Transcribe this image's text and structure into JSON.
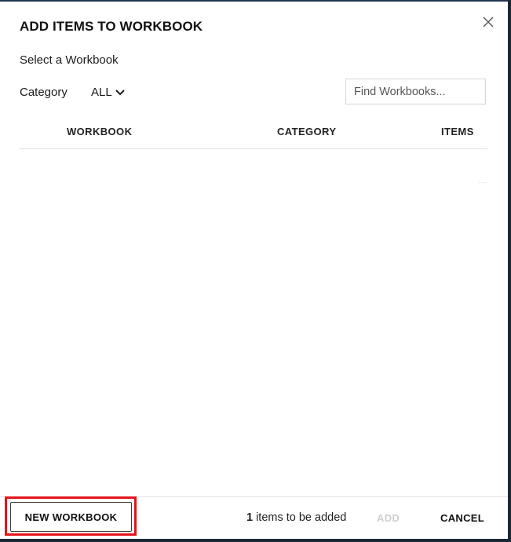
{
  "dialog": {
    "title": "ADD ITEMS TO WORKBOOK",
    "subtitle": "Select a Workbook",
    "close_icon": "close-icon"
  },
  "filters": {
    "category_label": "Category",
    "category_value": "ALL",
    "category_icon": "chevron-down-icon",
    "search_placeholder": "Find Workbooks..."
  },
  "table": {
    "columns": [
      "WORKBOOK",
      "CATEGORY",
      "ITEMS"
    ],
    "rows": []
  },
  "footer": {
    "new_workbook_label": "NEW WORKBOOK",
    "items_count": "1",
    "items_text": "items to be added",
    "add_label": "ADD",
    "cancel_label": "CANCEL",
    "highlight_color": "#e3141b"
  }
}
